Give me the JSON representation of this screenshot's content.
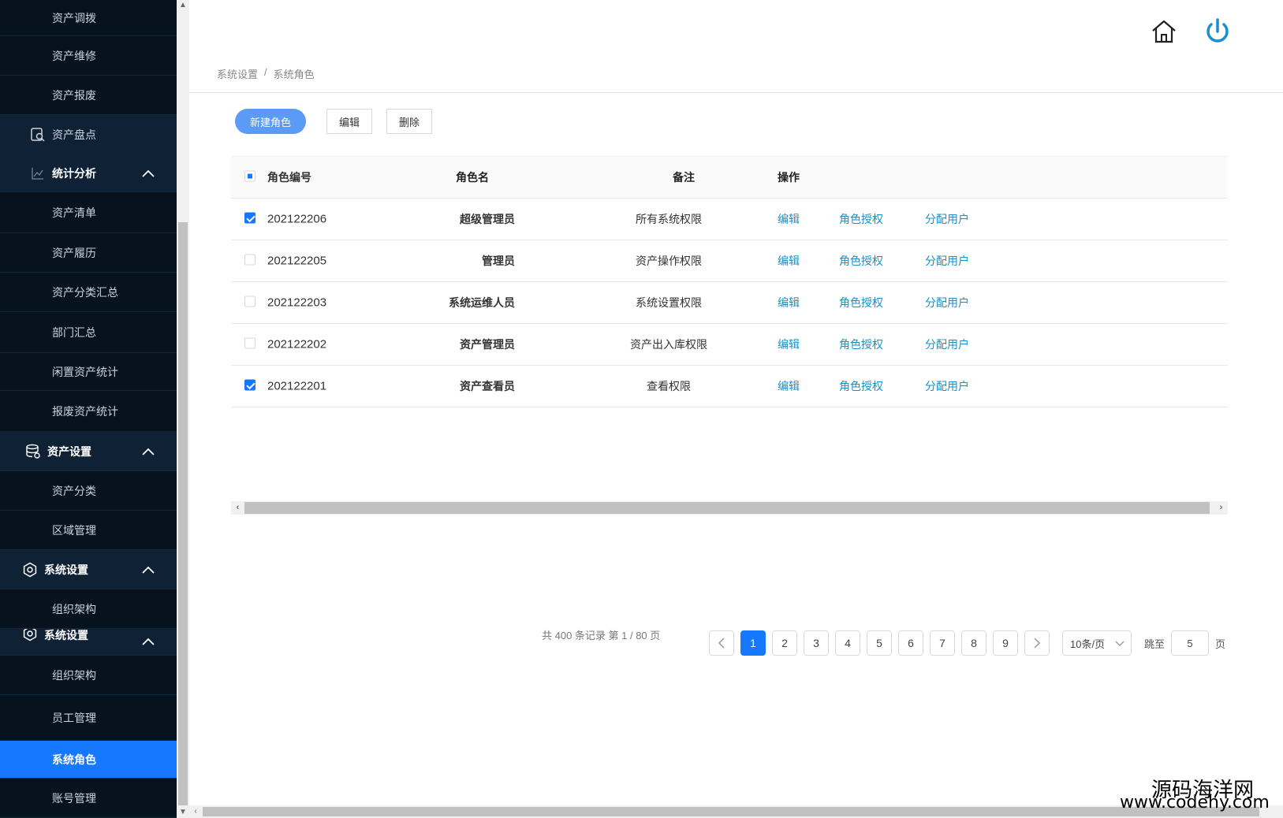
{
  "sidebar": {
    "items": [
      {
        "label": "资产调拨",
        "type": "sub"
      },
      {
        "label": "资产维修",
        "type": "sub"
      },
      {
        "label": "资产报废",
        "type": "sub"
      },
      {
        "label": "资产盘点",
        "type": "group-flat",
        "icon": "inventory-search-icon"
      },
      {
        "label": "统计分析",
        "type": "group",
        "icon": "line-chart-icon"
      },
      {
        "label": "资产清单",
        "type": "sub"
      },
      {
        "label": "资产履历",
        "type": "sub"
      },
      {
        "label": "资产分类汇总",
        "type": "sub"
      },
      {
        "label": "部门汇总",
        "type": "sub"
      },
      {
        "label": "闲置资产统计",
        "type": "sub"
      },
      {
        "label": "报废资产统计",
        "type": "sub"
      },
      {
        "label": "资产设置",
        "type": "group",
        "icon": "database-icon"
      },
      {
        "label": "资产分类",
        "type": "sub"
      },
      {
        "label": "区域管理",
        "type": "sub"
      },
      {
        "label": "系统设置",
        "type": "group",
        "icon": "gear-icon"
      },
      {
        "label": "组织架构",
        "type": "sub"
      },
      {
        "label": "系统设置",
        "type": "group",
        "icon": "gear-icon"
      },
      {
        "label": "组织架构",
        "type": "sub"
      },
      {
        "label": "员工管理",
        "type": "sub"
      },
      {
        "label": "系统角色",
        "type": "sub",
        "active": true
      },
      {
        "label": "账号管理",
        "type": "sub"
      }
    ]
  },
  "header": {
    "home_icon": "home-icon",
    "power_icon": "power-icon",
    "power_color": "#1a8fd0"
  },
  "breadcrumb": {
    "parent": "系统设置",
    "separator": "/",
    "current": "系统角色"
  },
  "toolbar": {
    "new_label": "新建角色",
    "edit_label": "编辑",
    "delete_label": "删除"
  },
  "table": {
    "headers": {
      "id": "角色编号",
      "name": "角色名",
      "remark": "备注",
      "ops": "操作"
    },
    "rows": [
      {
        "checked": true,
        "id": "202122206",
        "name": "超级管理员",
        "remark": "所有系统权限",
        "op1": "编辑",
        "op2": "角色授权",
        "op3": "分配用户"
      },
      {
        "checked": false,
        "id": "202122205",
        "name": "管理员",
        "remark": "资产操作权限",
        "op1": "编辑",
        "op2": "角色授权",
        "op3": "分配用户"
      },
      {
        "checked": false,
        "id": "202122203",
        "name": "系统运维人员",
        "remark": "系统设置权限",
        "op1": "编辑",
        "op2": "角色授权",
        "op3": "分配用户"
      },
      {
        "checked": false,
        "id": "202122202",
        "name": "资产管理员",
        "remark": "资产出入库权限",
        "op1": "编辑",
        "op2": "角色授权",
        "op3": "分配用户"
      },
      {
        "checked": true,
        "id": "202122201",
        "name": "资产查看员",
        "remark": "查看权限",
        "op1": "编辑",
        "op2": "角色授权",
        "op3": "分配用户"
      }
    ]
  },
  "pagination": {
    "summary": "共 400 条记录 第 1 / 80 页",
    "pages": [
      "1",
      "2",
      "3",
      "4",
      "5",
      "6",
      "7",
      "8",
      "9"
    ],
    "current": "1",
    "page_size": "10条/页",
    "jump_label": "跳至",
    "jump_value": "5",
    "page_suffix": "页"
  },
  "watermark": {
    "line1": "源码海洋网",
    "line2": "www.codehy.com"
  },
  "colors": {
    "sidebar_bg": "#0b1a2b",
    "active_bg": "#1677ff",
    "link": "#1890c8",
    "primary_button": "#5b9bf5"
  }
}
